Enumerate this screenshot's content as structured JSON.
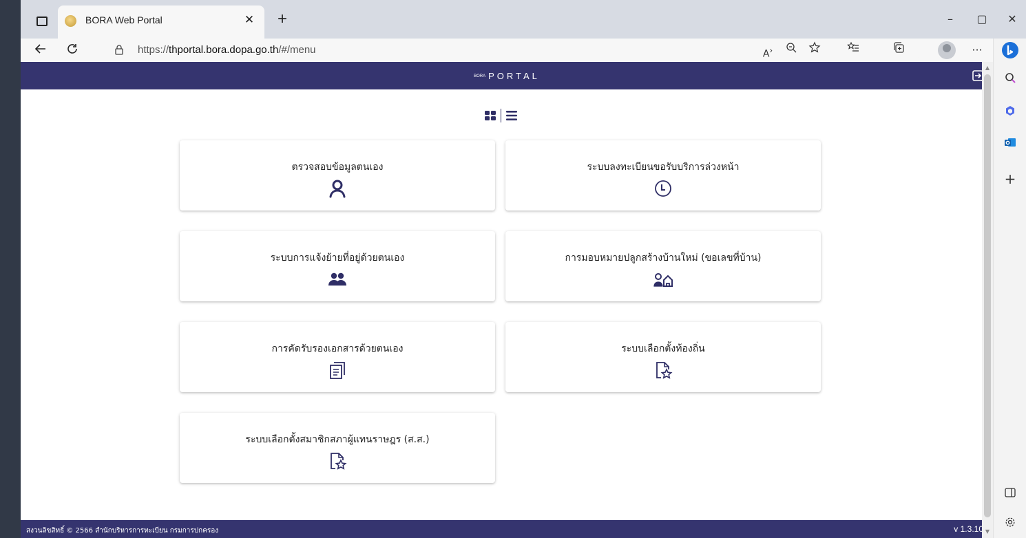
{
  "browser": {
    "tab_title": "BORA Web Portal",
    "tab_close": "✕",
    "new_tab": "+",
    "url_prefix": "https://",
    "url_host": "thportal.bora.dopa.go.th",
    "url_path": "/#/menu",
    "window_controls": {
      "minimize": "–",
      "maximize": "▢",
      "close": "✕"
    },
    "more_label": "···"
  },
  "portal": {
    "brand_small": "BORA",
    "brand_big": "PORTAL",
    "menu_items": [
      {
        "label": "ตรวจสอบข้อมูลตนเอง",
        "icon": "person-icon"
      },
      {
        "label": "ระบบลงทะเบียนขอรับบริการล่วงหน้า",
        "icon": "clock-icon"
      },
      {
        "label": "ระบบการแจ้งย้ายที่อยู่ด้วยตนเอง",
        "icon": "people-icon"
      },
      {
        "label": "การมอบหมายปลูกสร้างบ้านใหม่ (ขอเลขที่บ้าน)",
        "icon": "person-home-icon"
      },
      {
        "label": "การคัดรับรองเอกสารด้วยตนเอง",
        "icon": "documents-icon"
      },
      {
        "label": "ระบบเลือกตั้งท้องถิ่น",
        "icon": "document-star-icon"
      },
      {
        "label": "ระบบเลือกตั้งสมาชิกสภาผู้แทนราษฎร (ส.ส.)",
        "icon": "document-star-icon"
      }
    ],
    "footer_copyright": "สงวนลิขสิทธิ์ © 2566 สำนักบริหารการทะเบียน กรมการปกครอง",
    "version": "v 1.3.10",
    "colors": {
      "primary": "#35346f",
      "icon": "#2f2e66"
    }
  }
}
